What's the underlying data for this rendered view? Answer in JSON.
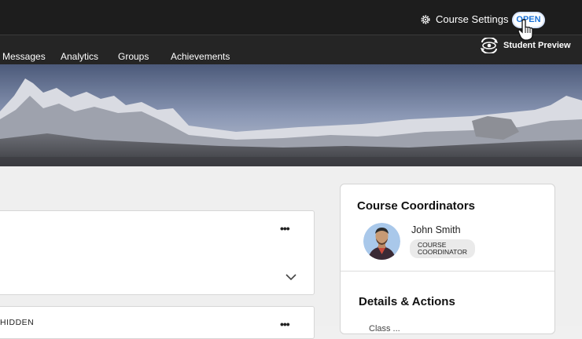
{
  "header": {
    "course_settings_label": "Course Settings",
    "open_toggle_label": "OPEN",
    "student_preview_label": "Student Preview"
  },
  "nav": {
    "items": [
      "Messages",
      "Analytics",
      "Groups",
      "Achievements"
    ]
  },
  "content": {
    "hidden_label": "HIDDEN"
  },
  "coordinators": {
    "title": "Course Coordinators",
    "person_name": "John Smith",
    "role_line1": "COURSE",
    "role_line2": "COORDINATOR"
  },
  "details": {
    "title": "Details & Actions",
    "partial_item": "Class ..."
  },
  "colors": {
    "topbar": "#1d1d1d",
    "navbar": "#252525",
    "toggle_text": "#1a73d9"
  }
}
